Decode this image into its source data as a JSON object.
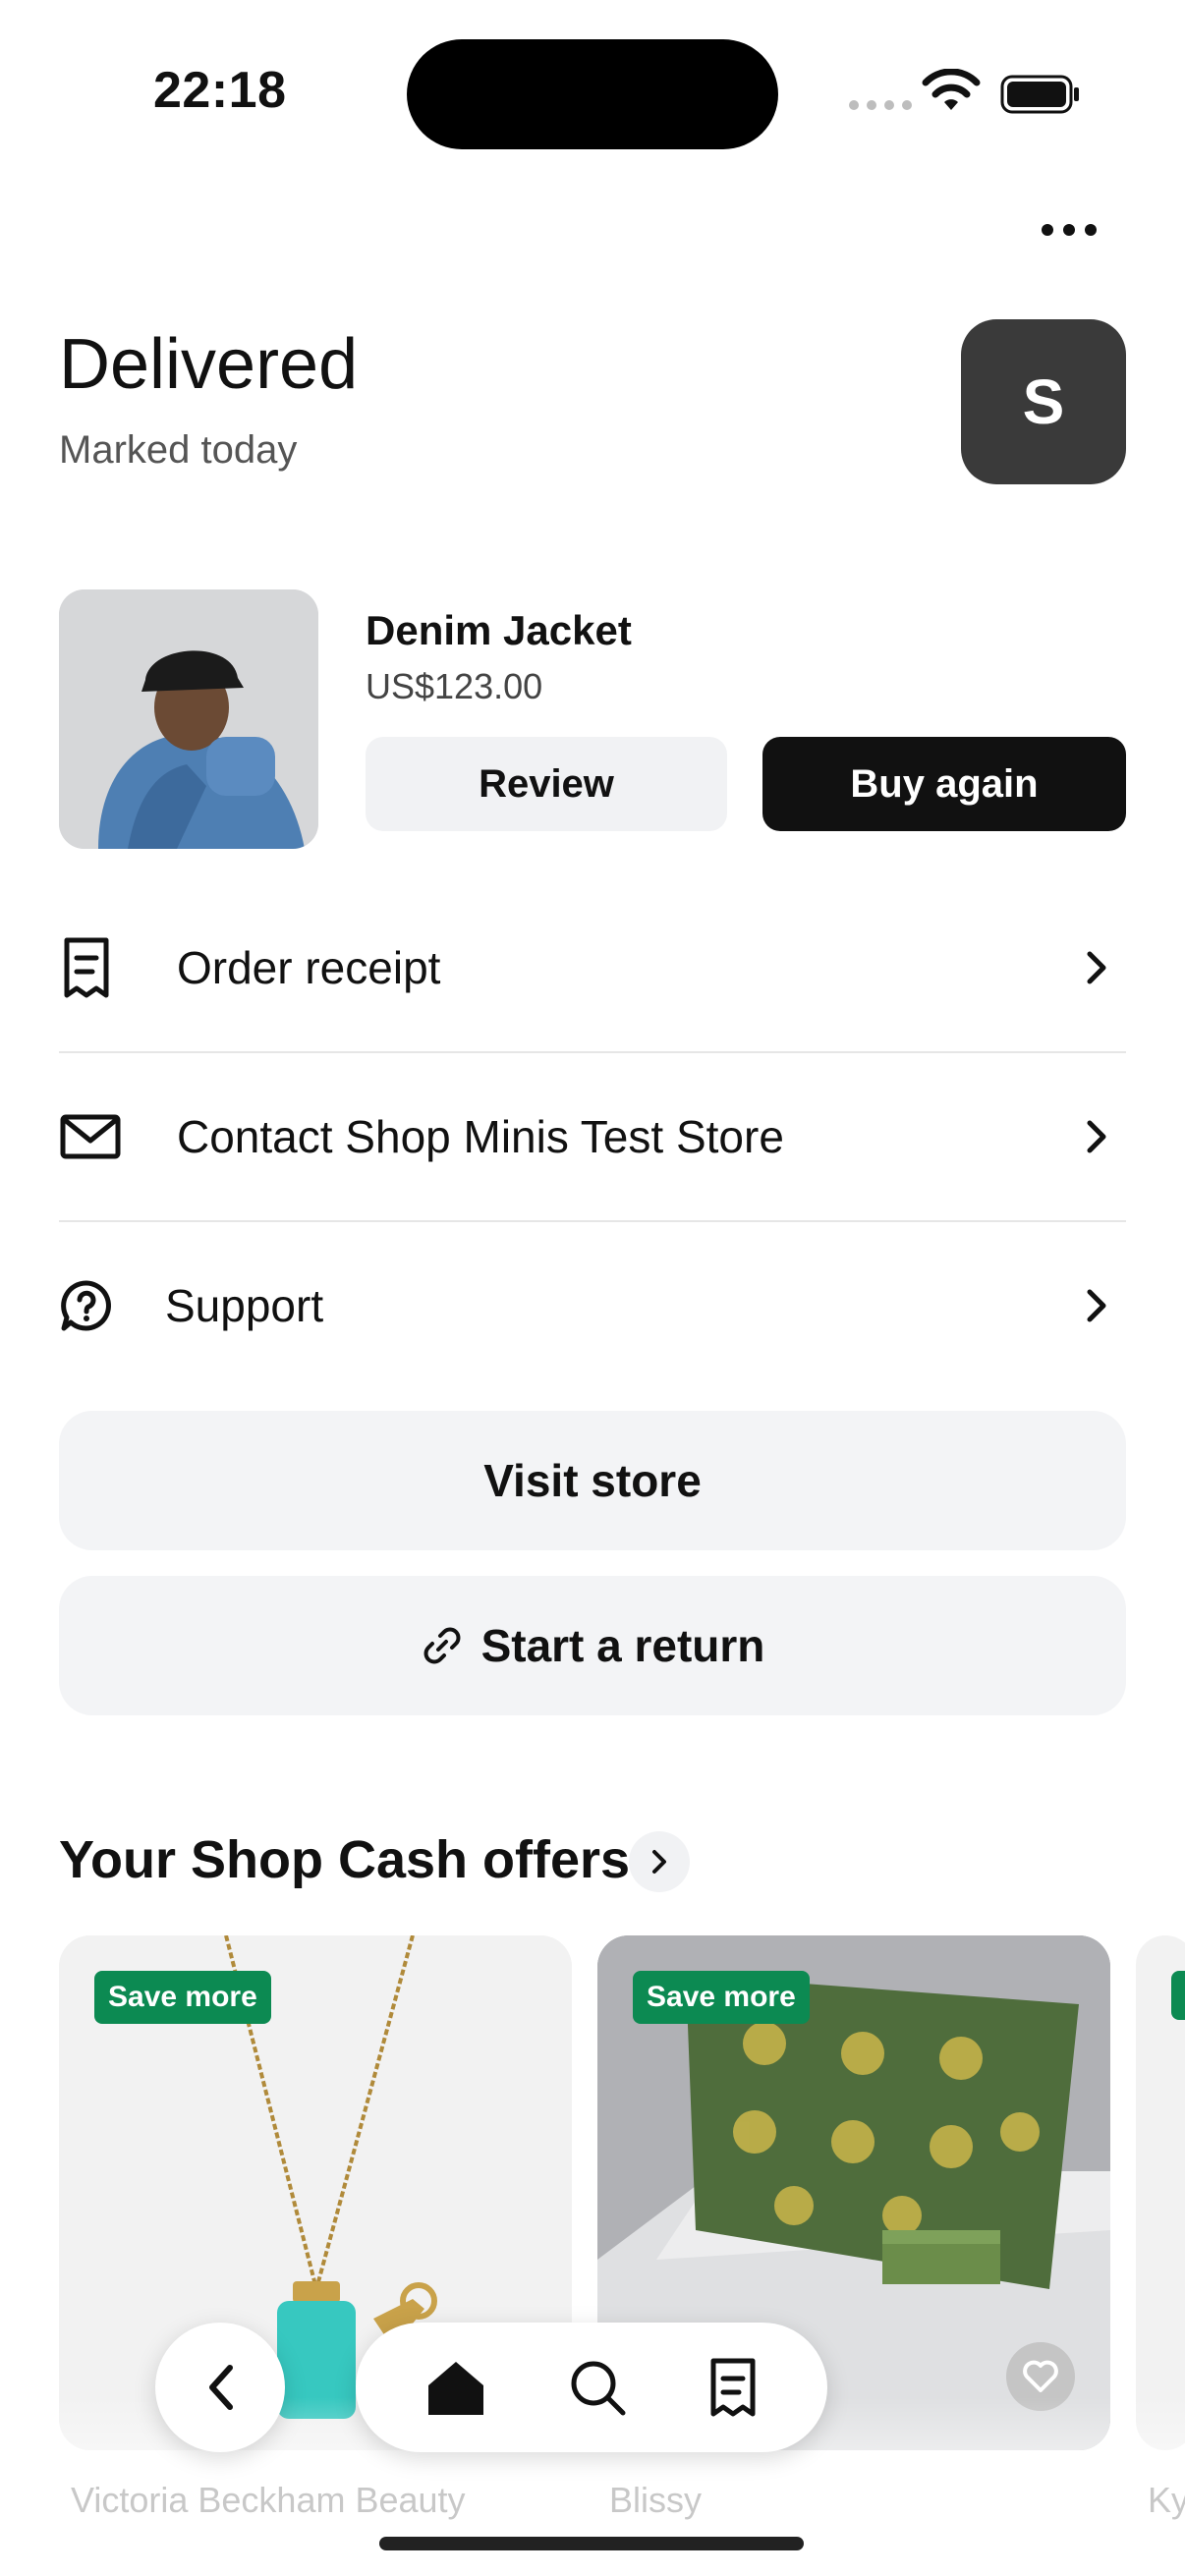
{
  "status_bar": {
    "time": "22:18"
  },
  "header": {
    "title": "Delivered",
    "subtitle": "Marked today",
    "avatar_letter": "S"
  },
  "product": {
    "name": "Denim Jacket",
    "price": "US$123.00",
    "review_label": "Review",
    "buy_again_label": "Buy again"
  },
  "rows": [
    {
      "label": "Order receipt",
      "icon": "receipt-icon"
    },
    {
      "label": "Contact Shop Minis Test Store",
      "icon": "mail-icon"
    },
    {
      "label": "Support",
      "icon": "support-icon"
    }
  ],
  "buttons": {
    "visit_store": "Visit store",
    "start_return": "Start a return"
  },
  "offers": {
    "title": "Your Shop Cash offers",
    "cards": [
      {
        "badge": "Save more",
        "store": "Victoria Beckham Beauty"
      },
      {
        "badge": "Save more",
        "store": "Blissy"
      },
      {
        "badge": "",
        "store": "Ky"
      }
    ]
  },
  "nav": {
    "items": [
      "back-icon",
      "home-icon",
      "search-icon",
      "orders-icon"
    ]
  },
  "colors": {
    "accent_green": "#0c8a52",
    "dark": "#111111",
    "avatar_bg": "#3a3a3a"
  }
}
